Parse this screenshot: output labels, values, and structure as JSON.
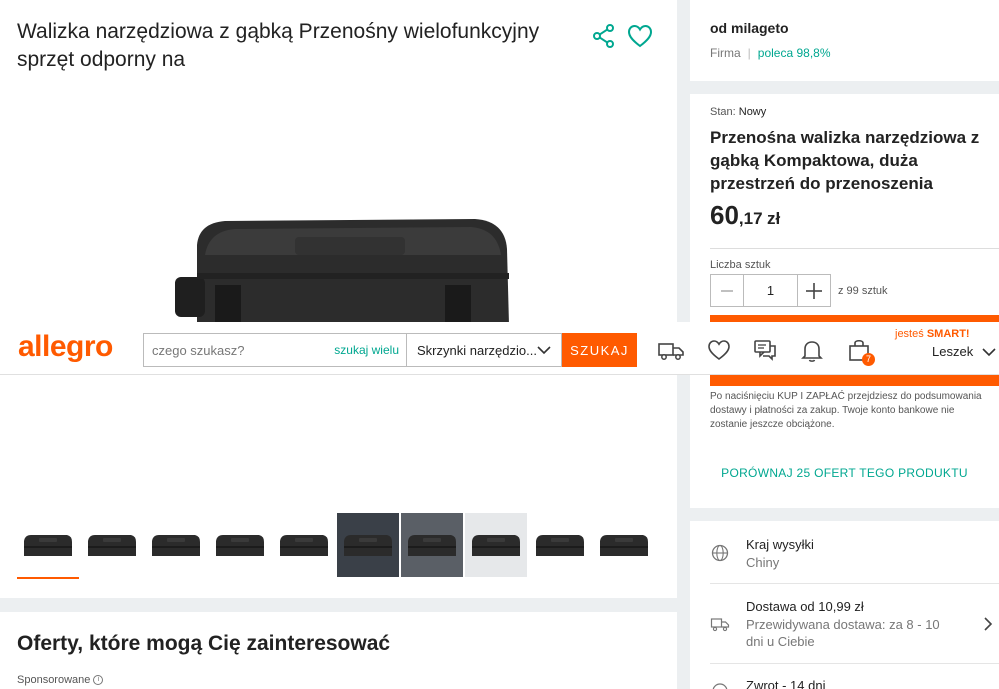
{
  "product": {
    "title": "Walizka narzędziowa z gąbką Przenośny wielofunkcyjny sprzęt odporny na",
    "thumb_count": 10
  },
  "seller": {
    "name": "od milageto",
    "type": "Firma",
    "separator": "|",
    "rating": "poleca 98,8%"
  },
  "offer": {
    "condition_label": "Stan:",
    "condition_value": "Nowy",
    "title": "Przenośna walizka narzędziowa z gąbką Kompaktowa, duża przestrzeń do przenoszenia",
    "price_int": "60",
    "price_dec": ",17",
    "price_cur": "zł",
    "qty_label": "Liczba sztuk",
    "qty_value": "1",
    "qty_of": "z 99 sztuk",
    "note": "Po naciśnięciu KUP I ZAPŁAĆ przejdziesz do podsumowania dostawy i płatności za zakup. Twoje konto bankowe nie zostanie jeszcze obciążone.",
    "compare": "PORÓWNAJ 25 OFERT TEGO PRODUKTU"
  },
  "shipping": {
    "country_title": "Kraj wysyłki",
    "country_value": "Chiny",
    "delivery_title": "Dostawa od 10,99 zł",
    "delivery_sub": "Przewidywana dostawa: za 8 - 10 dni u Ciebie",
    "return_title": "Zwrot - 14 dni"
  },
  "offers_section": {
    "title": "Oferty, które mogą Cię zainteresować",
    "sponsored": "Sponsorowane"
  },
  "header": {
    "logo": "allegro",
    "search_placeholder": "czego szukasz?",
    "search_many": "szukaj wielu",
    "category": "Skrzynki narzędzio...",
    "search_button": "SZUKAJ",
    "cart_count": "7",
    "smart_prefix": "jesteś",
    "smart_label": "SMART!",
    "user": "Leszek"
  },
  "colors": {
    "accent": "#ff5a00",
    "teal": "#00a790"
  }
}
